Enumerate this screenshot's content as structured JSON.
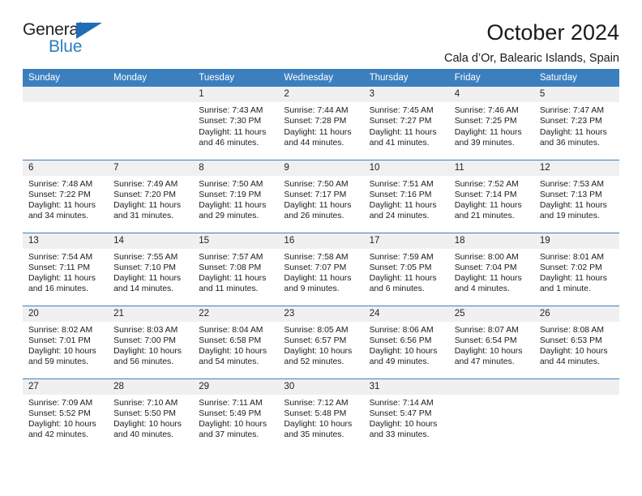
{
  "brand": {
    "name_part1": "General",
    "name_part2": "Blue",
    "triangle_color": "#1f6db5",
    "blue_text_color": "#2a7fc4"
  },
  "header": {
    "title": "October 2024",
    "subtitle": "Cala d’Or, Balearic Islands, Spain"
  },
  "theme": {
    "header_bg": "#3c7fbf",
    "daynum_bg": "#f0f0f0",
    "row_divider": "#3c7fbf"
  },
  "calendar": {
    "day_headers": [
      "Sunday",
      "Monday",
      "Tuesday",
      "Wednesday",
      "Thursday",
      "Friday",
      "Saturday"
    ],
    "weeks": [
      [
        {
          "day": "",
          "lines": []
        },
        {
          "day": "",
          "lines": []
        },
        {
          "day": "1",
          "lines": [
            "Sunrise: 7:43 AM",
            "Sunset: 7:30 PM",
            "Daylight: 11 hours and 46 minutes."
          ]
        },
        {
          "day": "2",
          "lines": [
            "Sunrise: 7:44 AM",
            "Sunset: 7:28 PM",
            "Daylight: 11 hours and 44 minutes."
          ]
        },
        {
          "day": "3",
          "lines": [
            "Sunrise: 7:45 AM",
            "Sunset: 7:27 PM",
            "Daylight: 11 hours and 41 minutes."
          ]
        },
        {
          "day": "4",
          "lines": [
            "Sunrise: 7:46 AM",
            "Sunset: 7:25 PM",
            "Daylight: 11 hours and 39 minutes."
          ]
        },
        {
          "day": "5",
          "lines": [
            "Sunrise: 7:47 AM",
            "Sunset: 7:23 PM",
            "Daylight: 11 hours and 36 minutes."
          ]
        }
      ],
      [
        {
          "day": "6",
          "lines": [
            "Sunrise: 7:48 AM",
            "Sunset: 7:22 PM",
            "Daylight: 11 hours and 34 minutes."
          ]
        },
        {
          "day": "7",
          "lines": [
            "Sunrise: 7:49 AM",
            "Sunset: 7:20 PM",
            "Daylight: 11 hours and 31 minutes."
          ]
        },
        {
          "day": "8",
          "lines": [
            "Sunrise: 7:50 AM",
            "Sunset: 7:19 PM",
            "Daylight: 11 hours and 29 minutes."
          ]
        },
        {
          "day": "9",
          "lines": [
            "Sunrise: 7:50 AM",
            "Sunset: 7:17 PM",
            "Daylight: 11 hours and 26 minutes."
          ]
        },
        {
          "day": "10",
          "lines": [
            "Sunrise: 7:51 AM",
            "Sunset: 7:16 PM",
            "Daylight: 11 hours and 24 minutes."
          ]
        },
        {
          "day": "11",
          "lines": [
            "Sunrise: 7:52 AM",
            "Sunset: 7:14 PM",
            "Daylight: 11 hours and 21 minutes."
          ]
        },
        {
          "day": "12",
          "lines": [
            "Sunrise: 7:53 AM",
            "Sunset: 7:13 PM",
            "Daylight: 11 hours and 19 minutes."
          ]
        }
      ],
      [
        {
          "day": "13",
          "lines": [
            "Sunrise: 7:54 AM",
            "Sunset: 7:11 PM",
            "Daylight: 11 hours and 16 minutes."
          ]
        },
        {
          "day": "14",
          "lines": [
            "Sunrise: 7:55 AM",
            "Sunset: 7:10 PM",
            "Daylight: 11 hours and 14 minutes."
          ]
        },
        {
          "day": "15",
          "lines": [
            "Sunrise: 7:57 AM",
            "Sunset: 7:08 PM",
            "Daylight: 11 hours and 11 minutes."
          ]
        },
        {
          "day": "16",
          "lines": [
            "Sunrise: 7:58 AM",
            "Sunset: 7:07 PM",
            "Daylight: 11 hours and 9 minutes."
          ]
        },
        {
          "day": "17",
          "lines": [
            "Sunrise: 7:59 AM",
            "Sunset: 7:05 PM",
            "Daylight: 11 hours and 6 minutes."
          ]
        },
        {
          "day": "18",
          "lines": [
            "Sunrise: 8:00 AM",
            "Sunset: 7:04 PM",
            "Daylight: 11 hours and 4 minutes."
          ]
        },
        {
          "day": "19",
          "lines": [
            "Sunrise: 8:01 AM",
            "Sunset: 7:02 PM",
            "Daylight: 11 hours and 1 minute."
          ]
        }
      ],
      [
        {
          "day": "20",
          "lines": [
            "Sunrise: 8:02 AM",
            "Sunset: 7:01 PM",
            "Daylight: 10 hours and 59 minutes."
          ]
        },
        {
          "day": "21",
          "lines": [
            "Sunrise: 8:03 AM",
            "Sunset: 7:00 PM",
            "Daylight: 10 hours and 56 minutes."
          ]
        },
        {
          "day": "22",
          "lines": [
            "Sunrise: 8:04 AM",
            "Sunset: 6:58 PM",
            "Daylight: 10 hours and 54 minutes."
          ]
        },
        {
          "day": "23",
          "lines": [
            "Sunrise: 8:05 AM",
            "Sunset: 6:57 PM",
            "Daylight: 10 hours and 52 minutes."
          ]
        },
        {
          "day": "24",
          "lines": [
            "Sunrise: 8:06 AM",
            "Sunset: 6:56 PM",
            "Daylight: 10 hours and 49 minutes."
          ]
        },
        {
          "day": "25",
          "lines": [
            "Sunrise: 8:07 AM",
            "Sunset: 6:54 PM",
            "Daylight: 10 hours and 47 minutes."
          ]
        },
        {
          "day": "26",
          "lines": [
            "Sunrise: 8:08 AM",
            "Sunset: 6:53 PM",
            "Daylight: 10 hours and 44 minutes."
          ]
        }
      ],
      [
        {
          "day": "27",
          "lines": [
            "Sunrise: 7:09 AM",
            "Sunset: 5:52 PM",
            "Daylight: 10 hours and 42 minutes."
          ]
        },
        {
          "day": "28",
          "lines": [
            "Sunrise: 7:10 AM",
            "Sunset: 5:50 PM",
            "Daylight: 10 hours and 40 minutes."
          ]
        },
        {
          "day": "29",
          "lines": [
            "Sunrise: 7:11 AM",
            "Sunset: 5:49 PM",
            "Daylight: 10 hours and 37 minutes."
          ]
        },
        {
          "day": "30",
          "lines": [
            "Sunrise: 7:12 AM",
            "Sunset: 5:48 PM",
            "Daylight: 10 hours and 35 minutes."
          ]
        },
        {
          "day": "31",
          "lines": [
            "Sunrise: 7:14 AM",
            "Sunset: 5:47 PM",
            "Daylight: 10 hours and 33 minutes."
          ]
        },
        {
          "day": "",
          "lines": []
        },
        {
          "day": "",
          "lines": []
        }
      ]
    ]
  }
}
